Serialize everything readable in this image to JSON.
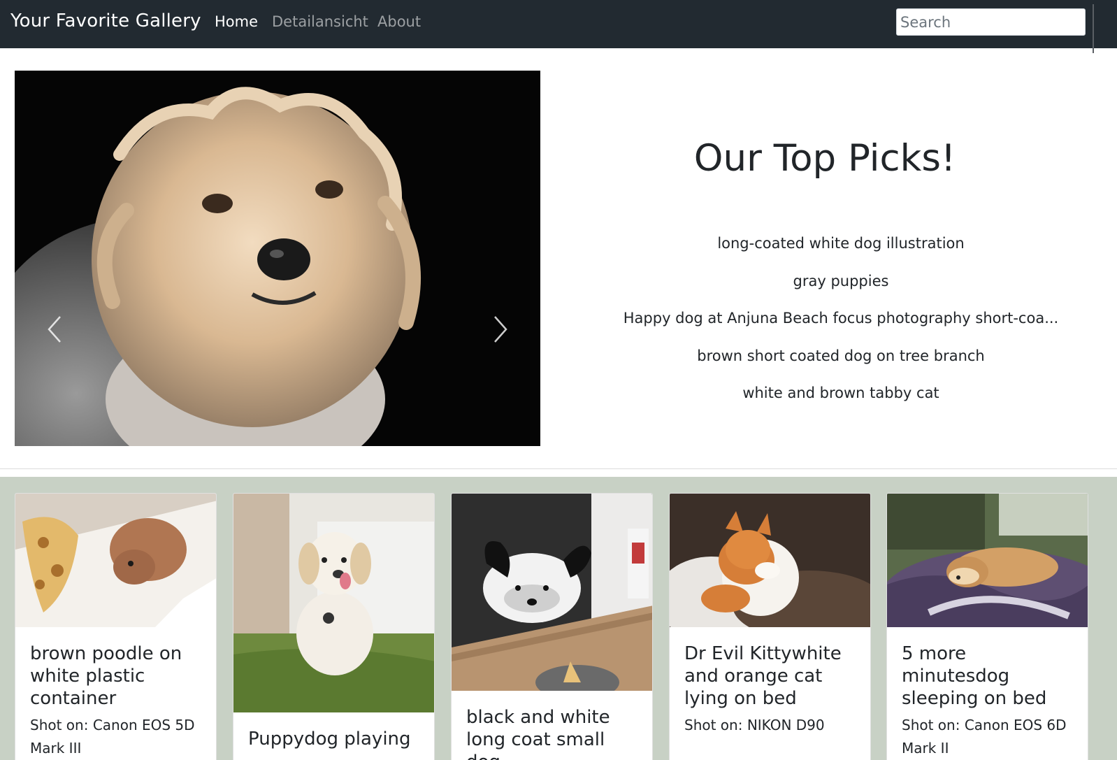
{
  "navbar": {
    "brand": "Your Favorite Gallery",
    "links": [
      "Home",
      "Detailansicht",
      "About"
    ],
    "search_placeholder": "Search"
  },
  "hero": {
    "title": "Our Top Picks!",
    "picks": [
      "long-coated white dog illustration",
      "gray puppies",
      "Happy dog at Anjuna Beach focus photography short-coa...",
      "brown short coated dog on tree branch",
      "white and brown tabby cat"
    ]
  },
  "cards": [
    {
      "title": "brown poodle on white plastic container",
      "text": "Shot on: Canon EOS 5D Mark III"
    },
    {
      "title": "Puppydog playing",
      "text": ""
    },
    {
      "title": "black and white long coat small dog",
      "text": ""
    },
    {
      "title": "Dr Evil Kittywhite and orange cat lying on bed",
      "text": "Shot on: NIKON D90"
    },
    {
      "title": "5 more minutesdog sleeping on bed",
      "text": "Shot on: Canon EOS 6D Mark II"
    }
  ],
  "colors": {
    "navbar_bg": "#222a31",
    "gallery_bg": "#c8d1c5"
  },
  "icons": {
    "carousel_prev": "chevron-left-icon",
    "carousel_next": "chevron-right-icon"
  }
}
